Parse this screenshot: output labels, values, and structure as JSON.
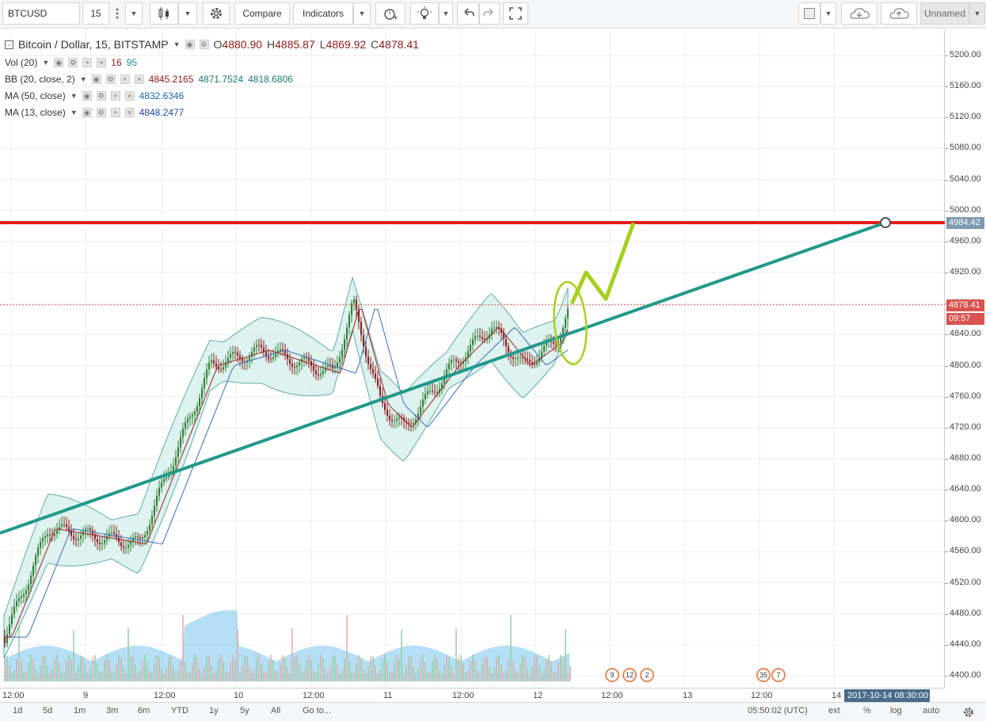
{
  "toolbar": {
    "symbol": "BTCUSD",
    "interval": "15",
    "compare_label": "Compare",
    "indicators_label": "Indicators",
    "layout_name": "Unnamed"
  },
  "legend": {
    "title": "Bitcoin / Dollar, 15, BITSTAMP",
    "o_key": "O",
    "o_val": "4880.90",
    "h_key": "H",
    "h_val": "4885.87",
    "l_key": "L",
    "l_val": "4869.92",
    "c_key": "C",
    "c_val": "4878.41",
    "vol_name": "Vol (20)",
    "vol_v1": "16",
    "vol_v2": "95",
    "bb_name": "BB (20, close, 2)",
    "bb_v1": "4845.2165",
    "bb_v2": "4871.7524",
    "bb_v3": "4818.6806",
    "ma50_name": "MA (50, close)",
    "ma50_v": "4832.6346",
    "ma13_name": "MA (13, close)",
    "ma13_v": "4848.2477"
  },
  "price_axis": {
    "labels": [
      "5200.00",
      "5160.00",
      "5120.00",
      "5080.00",
      "5040.00",
      "5000.00",
      "4960.00",
      "4920.00",
      "4880.00",
      "4840.00",
      "4800.00",
      "4760.00",
      "4720.00",
      "4680.00",
      "4640.00",
      "4600.00",
      "4560.00",
      "4520.00",
      "4480.00",
      "4440.00",
      "4400.00"
    ],
    "resistance_tag": "4984.42",
    "price_tag": "4878.41",
    "countdown_tag": "09:57"
  },
  "time_axis": {
    "labels": [
      "12:00",
      "9",
      "12:00",
      "10",
      "12:00",
      "11",
      "12:00",
      "12",
      "12:00",
      "13",
      "12:00",
      "14"
    ],
    "cursor_tag": "2017-10-14 08:30:00"
  },
  "events": [
    "9",
    "12",
    "2",
    "35",
    "7"
  ],
  "bottombar": {
    "ranges": [
      "1d",
      "5d",
      "1m",
      "3m",
      "6m",
      "YTD",
      "1y",
      "5y",
      "All"
    ],
    "goto_label": "Go to...",
    "clock": "05:50:02 (UTC)",
    "ext": "ext",
    "percent": "%",
    "log": "log",
    "auto": "auto"
  },
  "chart_data": {
    "type": "line",
    "title": "Bitcoin / Dollar, 15, BITSTAMP",
    "xlabel": "",
    "ylabel": "",
    "ylim": [
      4380,
      5220
    ],
    "x_ticks": [
      "12:00",
      "9",
      "12:00",
      "10",
      "12:00",
      "11",
      "12:00",
      "12",
      "12:00",
      "13",
      "12:00",
      "14"
    ],
    "grid": true,
    "series": [
      {
        "name": "",
        "x": [
          "8 12:00",
          "9 00:00",
          "9 12:00",
          "9 18:00",
          "10 00:00",
          "10 12:00",
          "10 18:00",
          "11 00:00",
          "11 06:00",
          "11 12:00",
          "11 18:00",
          "12 00:00",
          "12 06:00",
          "12 09:30"
        ],
        "values": [
          4450,
          4590,
          4570,
          4800,
          4820,
          4790,
          4880,
          4750,
          4720,
          4800,
          4850,
          4800,
          4830,
          4878
        ]
      }
    ],
    "horizontal_line": 4984.42,
    "last_price": 4878.41,
    "colors": {
      "resistance": "#e31b1b",
      "trendline": "#21998a",
      "projection": "#a6d021",
      "bb_fill": "#d7efec",
      "volume": "#5ab8e6",
      "up": "#2e7d32",
      "down": "#8b1a1a"
    }
  }
}
